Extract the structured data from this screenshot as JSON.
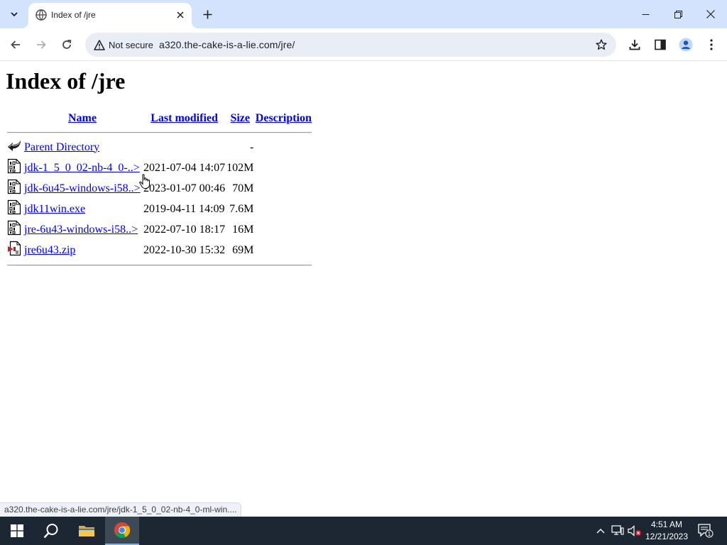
{
  "browser": {
    "tab": {
      "title": "Index of /jre"
    },
    "security_label": "Not secure",
    "url": "a320.the-cake-is-a-lie.com/jre/",
    "status_url": "a320.the-cake-is-a-lie.com/jre/jdk-1_5_0_02-nb-4_0-ml-win...."
  },
  "page": {
    "heading": "Index of /jre",
    "columns": {
      "name": "Name",
      "last_modified": "Last modified",
      "size": "Size",
      "description": "Description"
    },
    "parent": {
      "label": "Parent Directory",
      "size": "-"
    },
    "files": [
      {
        "name": "jdk-1_5_0_02-nb-4_0-..>",
        "modified": "2021-07-04 14:07",
        "size": "102M",
        "icon": "binary-file-icon"
      },
      {
        "name": "jdk-6u45-windows-i58..>",
        "modified": "2023-01-07 00:46",
        "size": "70M",
        "icon": "binary-file-icon"
      },
      {
        "name": "jdk11win.exe",
        "modified": "2019-04-11 14:09",
        "size": "7.6M",
        "icon": "binary-file-icon"
      },
      {
        "name": "jre-6u43-windows-i58..>",
        "modified": "2022-07-10 18:17",
        "size": "16M",
        "icon": "binary-file-icon"
      },
      {
        "name": "jre6u43.zip",
        "modified": "2022-10-30 15:32",
        "size": "69M",
        "icon": "compressed-file-icon"
      }
    ]
  },
  "taskbar": {
    "time": "4:51 AM",
    "date": "12/21/2023",
    "notification_count": "1"
  },
  "colors": {
    "tabstrip": "#d3e3fd",
    "link": "#0000ee",
    "taskbar": "#1c2733",
    "omnibox": "#e9eef6"
  }
}
